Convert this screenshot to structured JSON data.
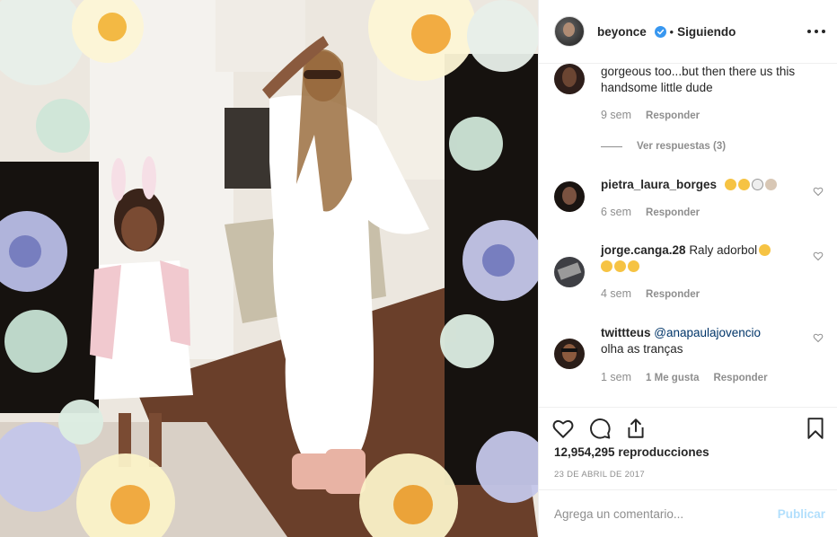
{
  "header": {
    "username": "beyonce",
    "separator": "•",
    "follow_label": "Siguiendo"
  },
  "comments": [
    {
      "text": "gorgeous too...but then there us this handsome little dude",
      "time": "9 sem",
      "reply_label": "Responder",
      "view_replies": "Ver respuestas (3)"
    },
    {
      "username": "pietra_laura_borges",
      "time": "6 sem",
      "reply_label": "Responder"
    },
    {
      "username": "jorge.canga.28",
      "text": "Raly adorbol",
      "time": "4 sem",
      "reply_label": "Responder"
    },
    {
      "username": "twittteus",
      "mention": "@anapaulajovencio",
      "text": "olha as tranças",
      "time": "1 sem",
      "likes_label": "1 Me gusta",
      "reply_label": "Responder"
    }
  ],
  "actions": {
    "views": "12,954,295 reproducciones",
    "date": "23 DE ABRIL DE 2017"
  },
  "add_comment": {
    "placeholder": "Agrega un comentario...",
    "post_label": "Publicar"
  },
  "colors": {
    "verified": "#3897f0",
    "mention": "#003569",
    "post_disabled": "#b2dffc"
  }
}
